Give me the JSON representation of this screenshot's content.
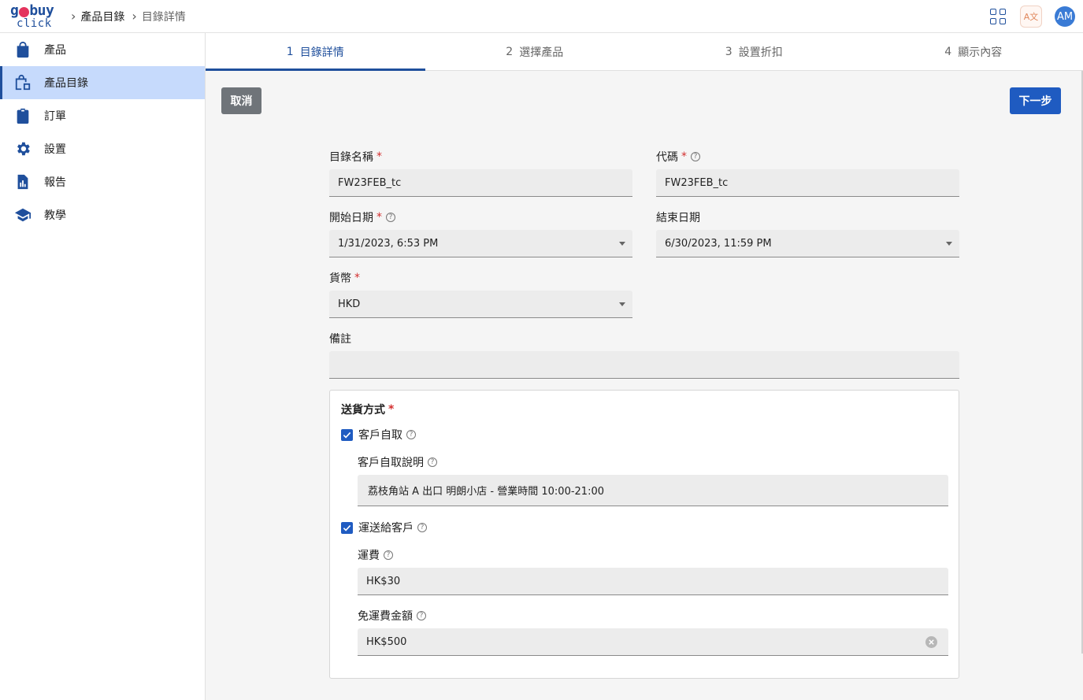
{
  "logo": {
    "line1_left": "g",
    "line1_right": "buy",
    "line2": "click"
  },
  "breadcrumb": {
    "items": [
      "產品目錄",
      "目錄詳情"
    ]
  },
  "topbar": {
    "translate_icon_text": "A文",
    "avatar_initials": "AM"
  },
  "sidebar": {
    "items": [
      {
        "label": "產品",
        "icon": "shopping-bag-icon"
      },
      {
        "label": "產品目錄",
        "icon": "catalog-bag-icon",
        "active": true
      },
      {
        "label": "訂單",
        "icon": "clipboard-icon"
      },
      {
        "label": "設置",
        "icon": "gear-icon"
      },
      {
        "label": "報告",
        "icon": "report-icon"
      },
      {
        "label": "教學",
        "icon": "graduation-cap-icon"
      }
    ]
  },
  "stepper": {
    "steps": [
      {
        "num": "1",
        "label": "目錄詳情",
        "active": true
      },
      {
        "num": "2",
        "label": "選擇產品"
      },
      {
        "num": "3",
        "label": "設置折扣"
      },
      {
        "num": "4",
        "label": "顯示內容"
      }
    ]
  },
  "actions": {
    "cancel": "取消",
    "next": "下一步"
  },
  "form": {
    "catalog_name": {
      "label": "目錄名稱",
      "required": "*",
      "value": "FW23FEB_tc"
    },
    "code": {
      "label": "代碼",
      "required": "*",
      "value": "FW23FEB_tc"
    },
    "start_date": {
      "label": "開始日期",
      "required": "*",
      "value": "1/31/2023, 6:53 PM"
    },
    "end_date": {
      "label": "結束日期",
      "value": "6/30/2023, 11:59 PM"
    },
    "currency": {
      "label": "貨幣",
      "required": "*",
      "value": "HKD"
    },
    "remarks": {
      "label": "備註",
      "value": ""
    },
    "delivery": {
      "title": "送貨方式",
      "required": "*",
      "pickup": {
        "label": "客戶自取",
        "checked": true
      },
      "pickup_desc": {
        "label": "客戶自取說明",
        "value": "荔枝角站 A 出口 明朗小店 - 營業時間 10:00-21:00"
      },
      "shipping": {
        "label": "運送給客戶",
        "checked": true
      },
      "shipping_fee": {
        "label": "運費",
        "value": "HK$30"
      },
      "free_shipping": {
        "label": "免運費金額",
        "value": "HK$500"
      }
    }
  },
  "colors": {
    "primary": "#1f4f9c",
    "button_blue": "#1f5bc1",
    "active_nav": "#c6dafc",
    "required": "#d32f2f"
  }
}
